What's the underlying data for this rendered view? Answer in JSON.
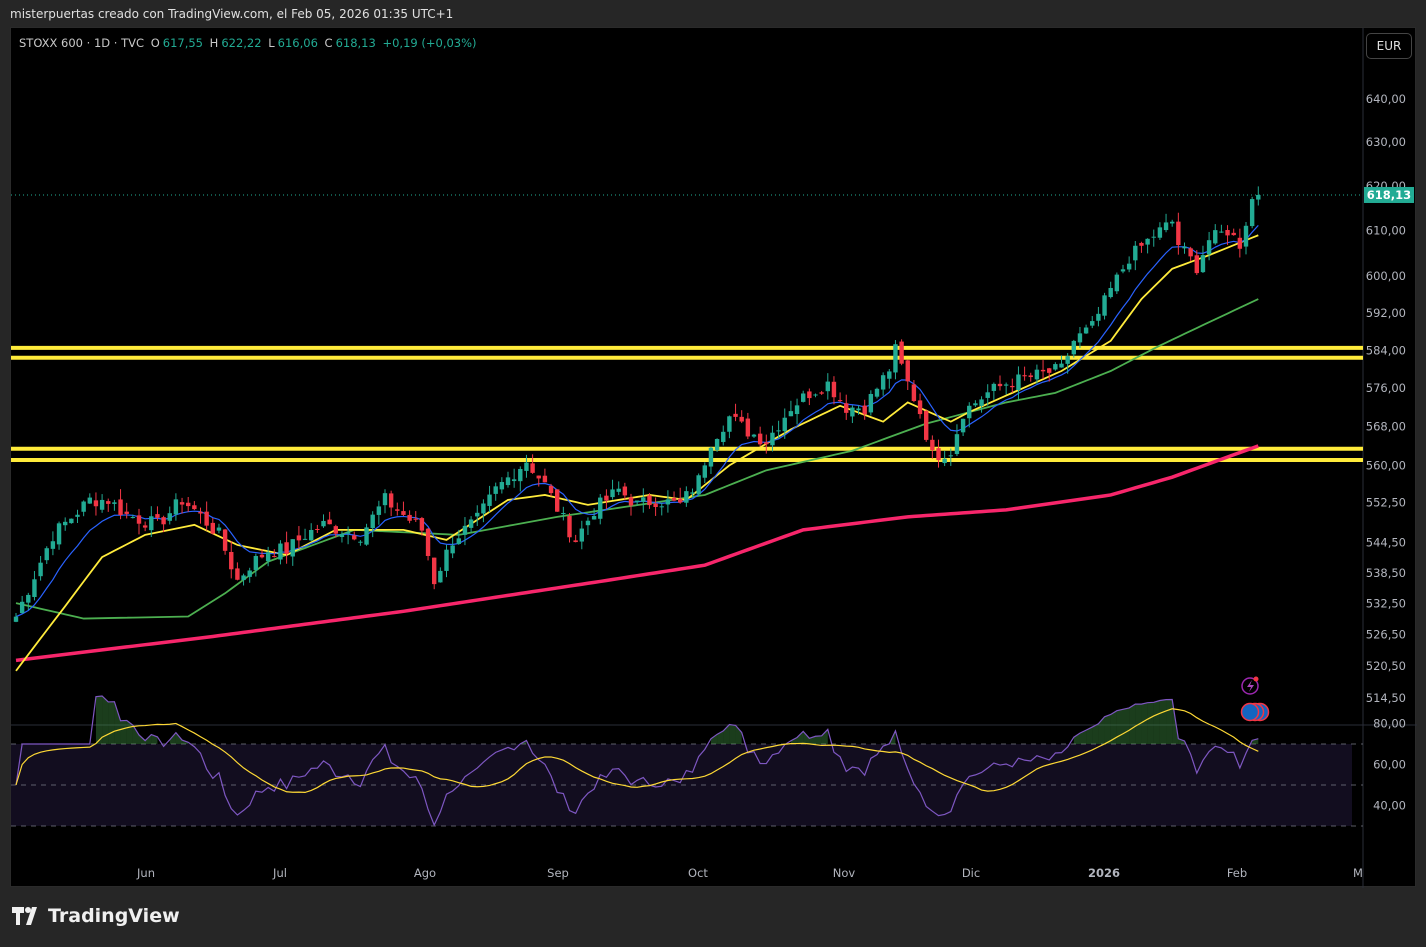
{
  "credit": "misterpuertas creado con TradingView.com, el Feb 05, 2026 01:35 UTC+1",
  "legend": {
    "symbol": "STOXX 600 · 1D · TVC",
    "o_label": "O",
    "o": "617,55",
    "h_label": "H",
    "h": "622,22",
    "l_label": "L",
    "l": "616,06",
    "c_label": "C",
    "c": "618,13",
    "change": "+0,19 (+0,03%)"
  },
  "currency": "EUR",
  "last_price_label": "618,13",
  "logo": "TradingView",
  "colors": {
    "up": "#22ab94",
    "down": "#f23645",
    "ema_fast": "#2962ff",
    "ema_20": "#ffeb3b",
    "ma_50": "#4caf50",
    "ma_200": "#f7266b",
    "rsi": "#7e57c2",
    "rsi_signal": "#fdd835",
    "levels": "#ffeb3b"
  },
  "chart_data": {
    "type": "candlestick",
    "scale": "log",
    "ylim": [
      510,
      645
    ],
    "price_ticks": [
      "640,00",
      "630,00",
      "620,00",
      "610,00",
      "600,00",
      "592,00",
      "584,00",
      "576,00",
      "568,00",
      "560,00",
      "552,50",
      "544,50",
      "538,50",
      "532,50",
      "526,50",
      "520,50",
      "514,50"
    ],
    "price_tick_values": [
      640,
      630,
      620,
      610,
      600,
      592,
      584,
      576,
      568,
      560,
      552.5,
      544.5,
      538.5,
      532.5,
      526.5,
      520.5,
      514.5
    ],
    "time_ticks": [
      "Jun",
      "Jul",
      "Ago",
      "Sep",
      "Oct",
      "Nov",
      "Dic",
      "2026",
      "Feb",
      "M"
    ],
    "close_keypoints": [
      [
        0,
        530
      ],
      [
        6,
        546
      ],
      [
        12,
        553
      ],
      [
        15,
        553
      ],
      [
        18,
        550
      ],
      [
        23,
        548
      ],
      [
        27,
        553
      ],
      [
        29,
        551
      ],
      [
        33,
        546
      ],
      [
        36,
        537
      ],
      [
        38,
        540
      ],
      [
        41,
        543
      ],
      [
        44,
        543
      ],
      [
        47,
        546
      ],
      [
        50,
        548
      ],
      [
        53,
        547
      ],
      [
        56,
        546
      ],
      [
        60,
        553
      ],
      [
        62,
        551
      ],
      [
        66,
        547
      ],
      [
        68,
        537
      ],
      [
        71,
        545
      ],
      [
        75,
        549
      ],
      [
        78,
        555
      ],
      [
        83,
        561
      ],
      [
        86,
        556
      ],
      [
        89,
        549
      ],
      [
        91,
        545
      ],
      [
        94,
        551
      ],
      [
        98,
        555
      ],
      [
        101,
        552
      ],
      [
        104,
        553
      ],
      [
        108,
        552
      ],
      [
        111,
        557
      ],
      [
        113,
        565
      ],
      [
        116,
        570
      ],
      [
        119,
        567
      ],
      [
        122,
        565
      ],
      [
        126,
        572
      ],
      [
        129,
        575
      ],
      [
        132,
        577
      ],
      [
        135,
        572
      ],
      [
        138,
        572
      ],
      [
        142,
        580
      ],
      [
        143,
        584
      ],
      [
        145,
        577
      ],
      [
        147,
        571
      ],
      [
        149,
        562
      ],
      [
        152,
        563
      ],
      [
        154,
        571
      ],
      [
        158,
        575
      ],
      [
        161,
        577
      ],
      [
        164,
        578
      ],
      [
        167,
        579
      ],
      [
        170,
        580
      ],
      [
        172,
        586
      ],
      [
        175,
        589
      ],
      [
        178,
        597
      ],
      [
        181,
        604
      ],
      [
        185,
        609
      ],
      [
        188,
        612
      ],
      [
        189,
        607
      ],
      [
        192,
        602
      ],
      [
        194,
        608
      ],
      [
        197,
        610
      ],
      [
        199,
        607
      ],
      [
        201,
        617
      ],
      [
        202,
        618
      ]
    ],
    "ema20_keypoints": [
      [
        0,
        519.6
      ],
      [
        8,
        532
      ],
      [
        14,
        541.6
      ],
      [
        21,
        546
      ],
      [
        29,
        548
      ],
      [
        36,
        544
      ],
      [
        44,
        542
      ],
      [
        52,
        547
      ],
      [
        63,
        547
      ],
      [
        70,
        545
      ],
      [
        80,
        553
      ],
      [
        86,
        554
      ],
      [
        93,
        552
      ],
      [
        103,
        554
      ],
      [
        109,
        553
      ],
      [
        116,
        560
      ],
      [
        126,
        567.4
      ],
      [
        134,
        572.3
      ],
      [
        141,
        569
      ],
      [
        145,
        573
      ],
      [
        152,
        569
      ],
      [
        155,
        571
      ],
      [
        162,
        575
      ],
      [
        170,
        579.6
      ],
      [
        178,
        586
      ],
      [
        183,
        595
      ],
      [
        188,
        601.6
      ],
      [
        194,
        604.6
      ],
      [
        202,
        609
      ]
    ],
    "ma50_keypoints": [
      [
        0,
        532.6
      ],
      [
        11,
        529.6
      ],
      [
        28,
        530
      ],
      [
        34,
        534.5
      ],
      [
        41,
        540.7
      ],
      [
        55,
        547
      ],
      [
        72,
        546
      ],
      [
        88,
        549.6
      ],
      [
        104,
        552.5
      ],
      [
        112,
        554
      ],
      [
        122,
        559
      ],
      [
        136,
        563
      ],
      [
        148,
        568.6
      ],
      [
        161,
        573
      ],
      [
        169,
        575
      ],
      [
        178,
        579.6
      ],
      [
        186,
        585
      ],
      [
        194,
        590
      ],
      [
        202,
        595
      ]
    ],
    "ma200_keypoints": [
      [
        0,
        521.6
      ],
      [
        31,
        526
      ],
      [
        63,
        531
      ],
      [
        96,
        537
      ],
      [
        112,
        540
      ],
      [
        128,
        547
      ],
      [
        145,
        549.6
      ],
      [
        161,
        551
      ],
      [
        178,
        554
      ],
      [
        188,
        557.6
      ],
      [
        202,
        564
      ]
    ],
    "horizontal_levels": [
      584.5,
      582.4,
      563.4,
      561.1
    ],
    "rsi": {
      "ticks": [
        "80,00",
        "60,00",
        "40,00"
      ],
      "tick_values": [
        80,
        60,
        40
      ],
      "bands": [
        70,
        50,
        30
      ],
      "period": 14
    }
  }
}
